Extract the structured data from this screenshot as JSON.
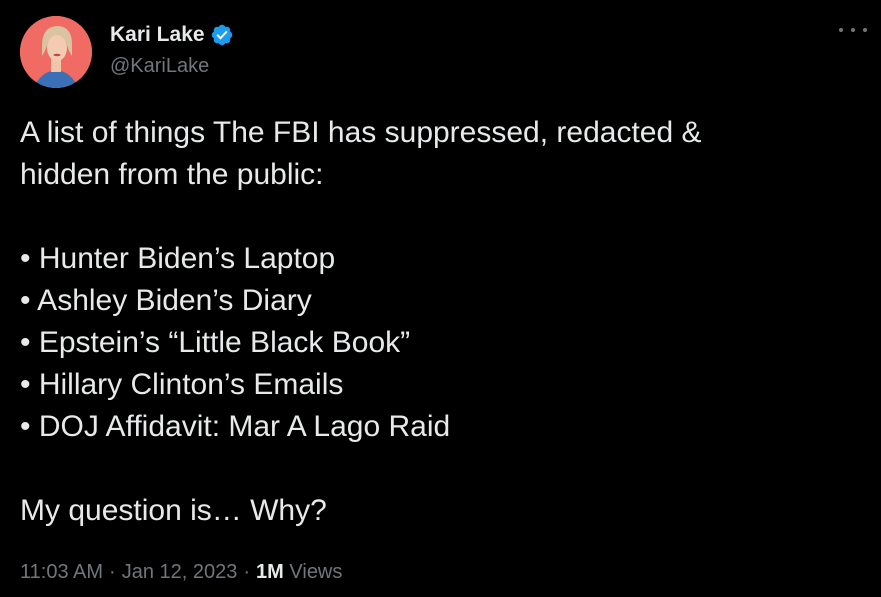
{
  "author": {
    "display_name": "Kari Lake",
    "handle": "@KariLake",
    "verified": true
  },
  "tweet": {
    "intro_line_1": "A list of things The FBI has suppressed, redacted &",
    "intro_line_2": "hidden from the public:",
    "bullets": [
      "• Hunter Biden’s Laptop",
      "• Ashley Biden’s Diary",
      "• Epstein’s “Little Black Book”",
      "• Hillary Clinton’s Emails",
      "• DOJ Affidavit: Mar A Lago Raid"
    ],
    "closing": "My question is… Why?"
  },
  "meta": {
    "time": "11:03 AM",
    "date": "Jan 12, 2023",
    "views_count": "1M",
    "views_label": "Views",
    "separator": "·"
  },
  "icons": {
    "verified": "verified-badge-icon",
    "more": "more-icon"
  },
  "colors": {
    "background": "#000000",
    "primary_text": "#e7e9ea",
    "secondary_text": "#71767b",
    "verified_blue": "#1d9bf0"
  }
}
